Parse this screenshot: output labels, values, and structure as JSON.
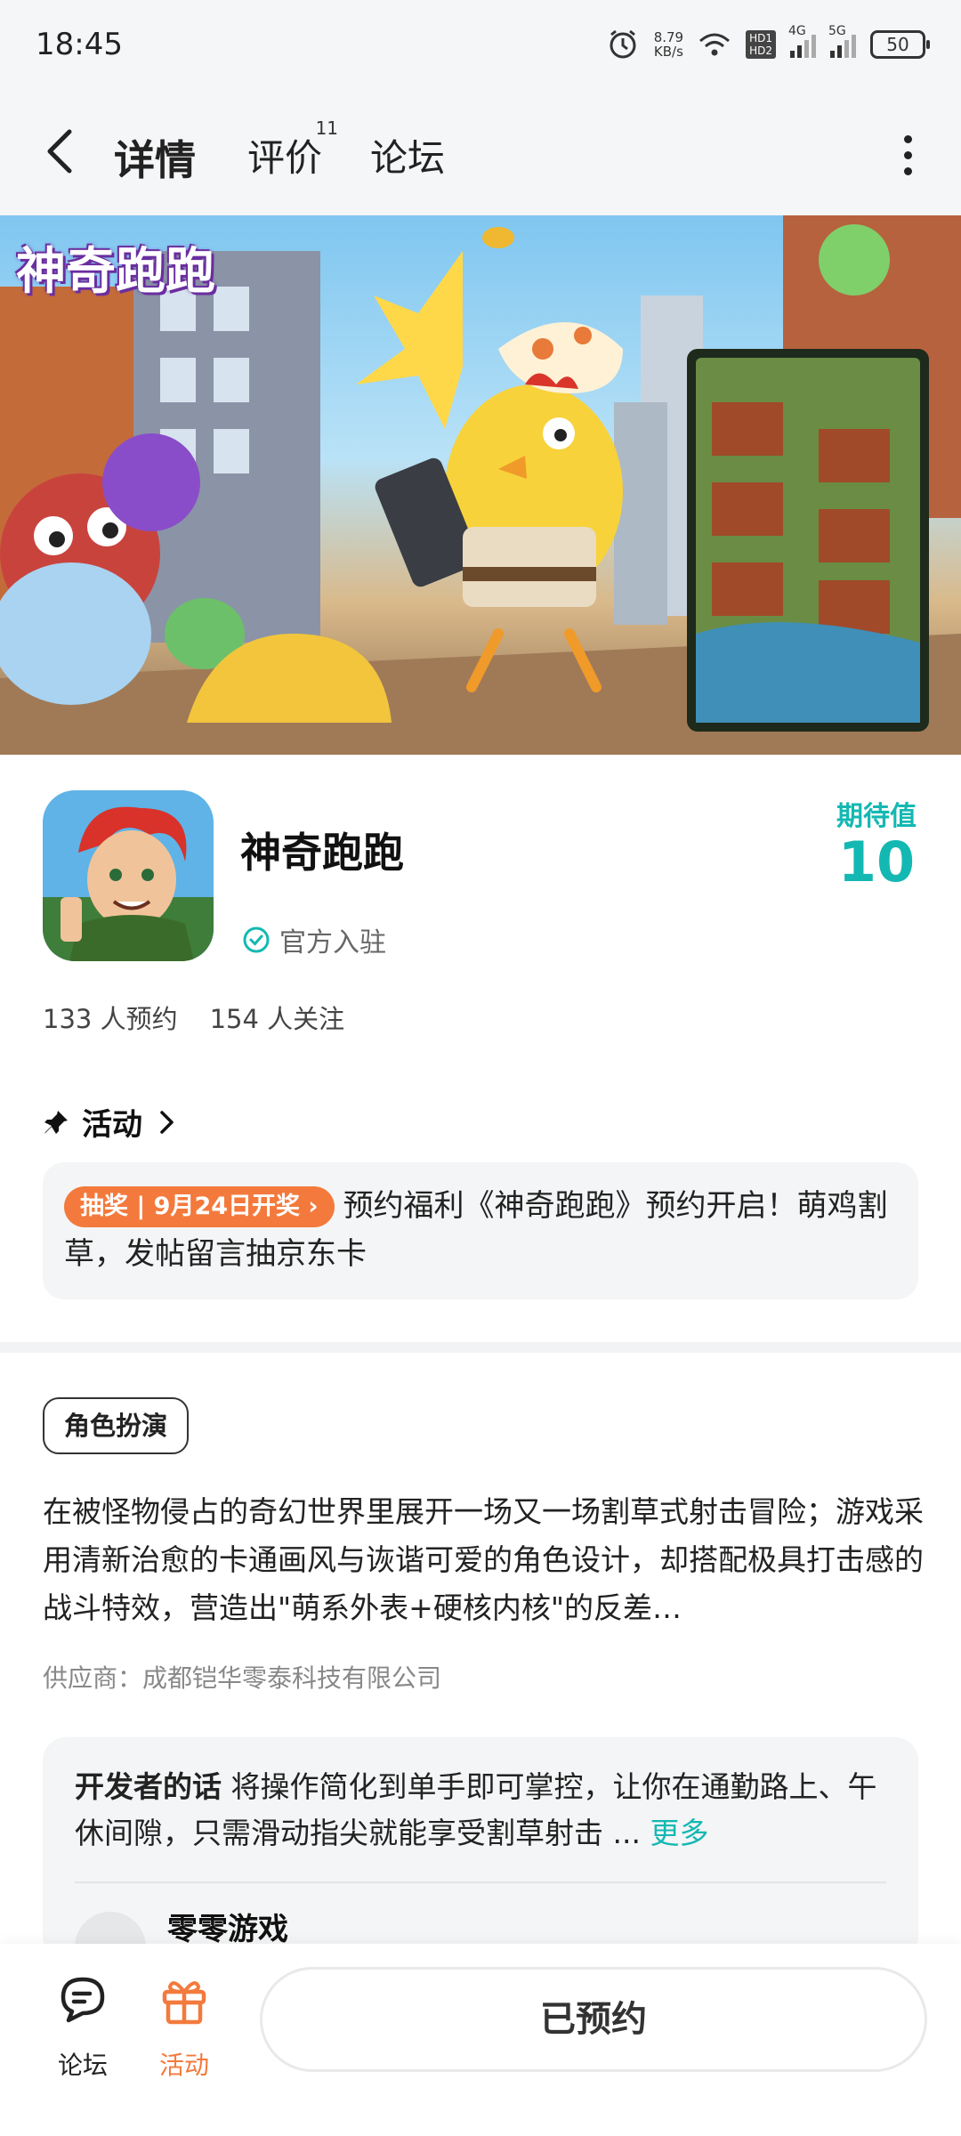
{
  "status_bar": {
    "time": "18:45",
    "net_speed_value": "8.79",
    "net_speed_unit": "KB/s",
    "hd1": "HD1",
    "hd2": "HD2",
    "sig1_label": "4G",
    "sig2_label": "5G",
    "battery": "50"
  },
  "nav": {
    "tabs": [
      {
        "label": "详情",
        "active": true
      },
      {
        "label": "评价",
        "badge": "11"
      },
      {
        "label": "论坛"
      }
    ]
  },
  "banner": {
    "logo_text": "神奇跑跑"
  },
  "app": {
    "name": "神奇跑跑",
    "official_label": "官方入驻",
    "expect_label": "期待值",
    "expect_value": "10",
    "reservations": "133 人预约",
    "followers": "154 人关注"
  },
  "activity": {
    "title": "活动",
    "badge": "抽奖 | 9月24日开奖 ›",
    "text": "预约福利《神奇跑跑》预约开启！萌鸡割草，发帖留言抽京东卡"
  },
  "details": {
    "tag": "角色扮演",
    "description": "在被怪物侵占的奇幻世界里展开一场又一场割草式射击冒险；游戏采用清新治愈的卡通画风与诙谐可爱的角色设计，却搭配极具打击感的战斗特效，营造出\"萌系外表+硬核内核\"的反差…",
    "supplier": "供应商：成都铠华零泰科技有限公司"
  },
  "developer": {
    "label": "开发者的话",
    "text": "将操作简化到单手即可掌控，让你在通勤路上、午休间隙，只需滑动指尖就能享受割草射击 ...",
    "more": "更多",
    "name": "零零游戏"
  },
  "bottom": {
    "forum_label": "论坛",
    "activity_label": "活动",
    "reserve_label": "已预约"
  },
  "colors": {
    "accent": "#14c8c1",
    "orange": "#f37a3c"
  }
}
